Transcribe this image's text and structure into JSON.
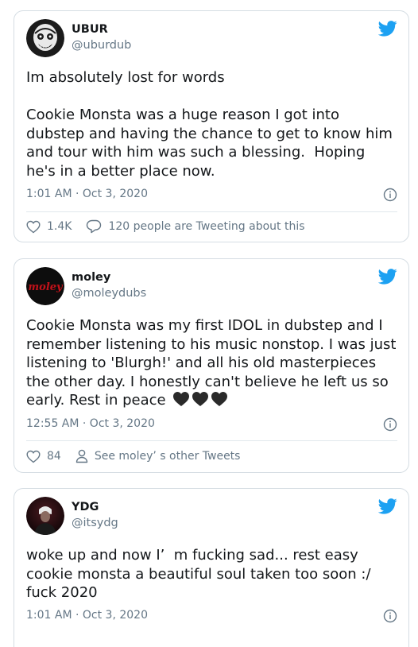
{
  "colors": {
    "brand_blue": "#1da1f2",
    "text": "#14171a",
    "muted": "#657786",
    "border": "#d5dde3"
  },
  "tweets": [
    {
      "name": "UBUR",
      "handle": "@uburdub",
      "text": "Im absolutely lost for words\n\nCookie Monsta was a huge reason I got into dubstep and having the chance to get to know him and tour with him was such a blessing.  Hoping he's in a better place now.",
      "timestamp": "1:01 AM · Oct 3, 2020",
      "likes": "1.4K",
      "secondary_action": "120 people are Tweeting about this",
      "secondary_icon": "reply-icon"
    },
    {
      "name": "moley",
      "handle": "@moleydubs",
      "avatar_text": "moley",
      "text": "Cookie Monsta was my first IDOL in dubstep and I remember listening to his music nonstop. I was just listening to 'Blurgh!' and all his old masterpieces the other day. I honestly can't believe he left us so early. Rest in peace",
      "timestamp": "12:55 AM · Oct 3, 2020",
      "likes": "84",
      "secondary_action": "See moley’ s other Tweets",
      "secondary_icon": "person-icon"
    },
    {
      "name": "YDG",
      "handle": "@itsydg",
      "text": "woke up and now I’  m fucking sad... rest easy cookie monsta a beautiful soul taken too soon :/ fuck 2020",
      "timestamp": "1:01 AM · Oct 3, 2020"
    }
  ]
}
